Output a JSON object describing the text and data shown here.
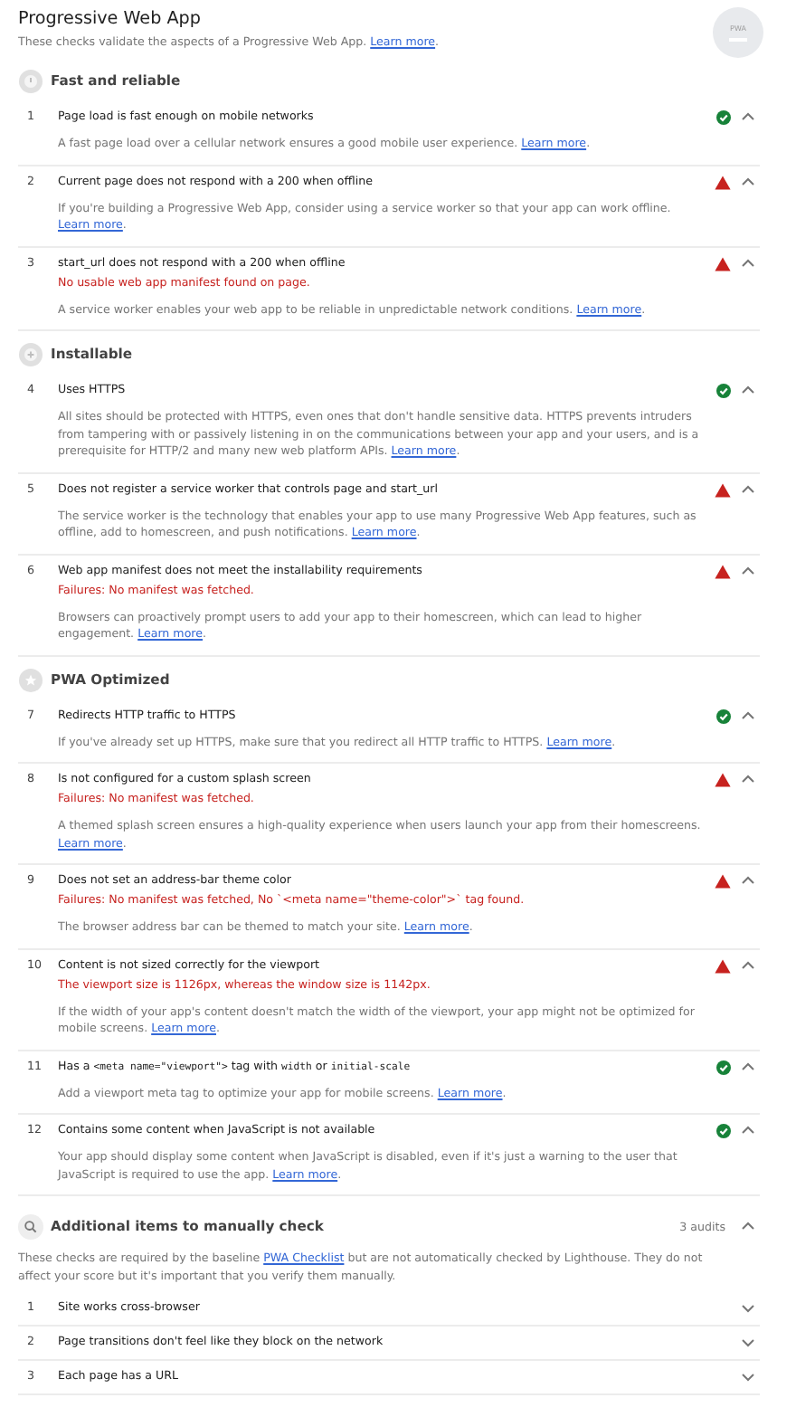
{
  "report": {
    "title": "Progressive Web App",
    "intro": "These checks validate the aspects of a Progressive Web App. ",
    "intro_link": "Learn more",
    "intro_after": ".",
    "badge": "PWA"
  },
  "groups": [
    {
      "title": "Fast and reliable",
      "audits": [
        {
          "number": "1",
          "title": "Page load is fast enough on mobile networks",
          "kind": "pass",
          "expanded": true,
          "description": "A fast page load over a cellular network ensures a good mobile user experience. ",
          "link": "Learn more",
          "after": "."
        },
        {
          "number": "2",
          "title": "Current page does not respond with a 200 when offline",
          "kind": "fail",
          "expanded": true,
          "description": "If you're building a Progressive Web App, consider using a service worker so that your app can work offline. ",
          "link": "Learn more",
          "after": "."
        },
        {
          "number": "3",
          "title": "start_url does not respond with a 200 when offline",
          "kind": "fail",
          "expanded": true,
          "failure": "No usable web app manifest found on page.",
          "description": "A service worker enables your web app to be reliable in unpredictable network conditions. ",
          "link": "Learn more",
          "after": "."
        }
      ]
    },
    {
      "title": "Installable",
      "audits": [
        {
          "number": "4",
          "title": "Uses HTTPS",
          "kind": "pass",
          "expanded": true,
          "description": "All sites should be protected with HTTPS, even ones that don't handle sensitive data. HTTPS prevents intruders from tampering with or passively listening in on the communications between your app and your users, and is a prerequisite for HTTP/2 and many new web platform APIs. ",
          "link": "Learn more",
          "after": "."
        },
        {
          "number": "5",
          "title": "Does not register a service worker that controls page and start_url",
          "kind": "fail",
          "expanded": true,
          "description": "The service worker is the technology that enables your app to use many Progressive Web App features, such as offline, add to homescreen, and push notifications. ",
          "link": "Learn more",
          "after": "."
        },
        {
          "number": "6",
          "title": "Web app manifest does not meet the installability requirements",
          "kind": "fail",
          "expanded": true,
          "failure": "Failures: No manifest was fetched.",
          "description": "Browsers can proactively prompt users to add your app to their homescreen, which can lead to higher engagement. ",
          "link": "Learn more",
          "after": "."
        }
      ]
    },
    {
      "title": "PWA Optimized",
      "audits": [
        {
          "number": "7",
          "title": "Redirects HTTP traffic to HTTPS",
          "kind": "pass",
          "expanded": true,
          "description": "If you've already set up HTTPS, make sure that you redirect all HTTP traffic to HTTPS. ",
          "link": "Learn more",
          "after": "."
        },
        {
          "number": "8",
          "title": "Is not configured for a custom splash screen",
          "kind": "fail",
          "expanded": true,
          "failure": "Failures: No manifest was fetched.",
          "description": "A themed splash screen ensures a high-quality experience when users launch your app from their homescreens. ",
          "link": "Learn more",
          "after": "."
        },
        {
          "number": "9",
          "title": "Does not set an address-bar theme color",
          "kind": "fail",
          "expanded": true,
          "failure": "Failures: No manifest was fetched, No `<meta name=\"theme-color\">` tag found.",
          "description": "The browser address bar can be themed to match your site. ",
          "link": "Learn more",
          "after": "."
        },
        {
          "number": "10",
          "title": "Content is not sized correctly for the viewport",
          "kind": "fail",
          "expanded": true,
          "failure": "The viewport size is 1126px, whereas the window size is 1142px.",
          "description": "If the width of your app's content doesn't match the width of the viewport, your app might not be optimized for mobile screens. ",
          "link": "Learn more",
          "after": "."
        },
        {
          "number": "11",
          "title_parts": [
            {
              "kind": "text",
              "text": "Has a "
            },
            {
              "kind": "code",
              "text": "<meta name=\"viewport\">"
            },
            {
              "kind": "text",
              "text": " tag with "
            },
            {
              "kind": "code",
              "text": "width"
            },
            {
              "kind": "text",
              "text": " or "
            },
            {
              "kind": "code",
              "text": "initial-scale"
            }
          ],
          "kind": "pass",
          "expanded": true,
          "description": "Add a viewport meta tag to optimize your app for mobile screens. ",
          "link": "Learn more",
          "after": "."
        },
        {
          "number": "12",
          "title": "Contains some content when JavaScript is not available",
          "kind": "pass",
          "expanded": true,
          "description": "Your app should display some content when JavaScript is disabled, even if it's just a warning to the user that JavaScript is required to use the app. ",
          "link": "Learn more",
          "after": "."
        }
      ]
    }
  ],
  "manual": {
    "title": "Additional items to manually check",
    "count": "3 audits",
    "expanded": true,
    "description": "These checks are required by the baseline ",
    "link": "PWA Checklist",
    "after": " but are not automatically checked by Lighthouse. They do not affect your score but it's important that you verify them manually.",
    "items": [
      {
        "number": "1",
        "title": "Site works cross-browser",
        "expanded": false
      },
      {
        "number": "2",
        "title": "Page transitions don't feel like they block on the network",
        "expanded": false
      },
      {
        "number": "3",
        "title": "Each page has a URL",
        "expanded": false
      }
    ]
  }
}
